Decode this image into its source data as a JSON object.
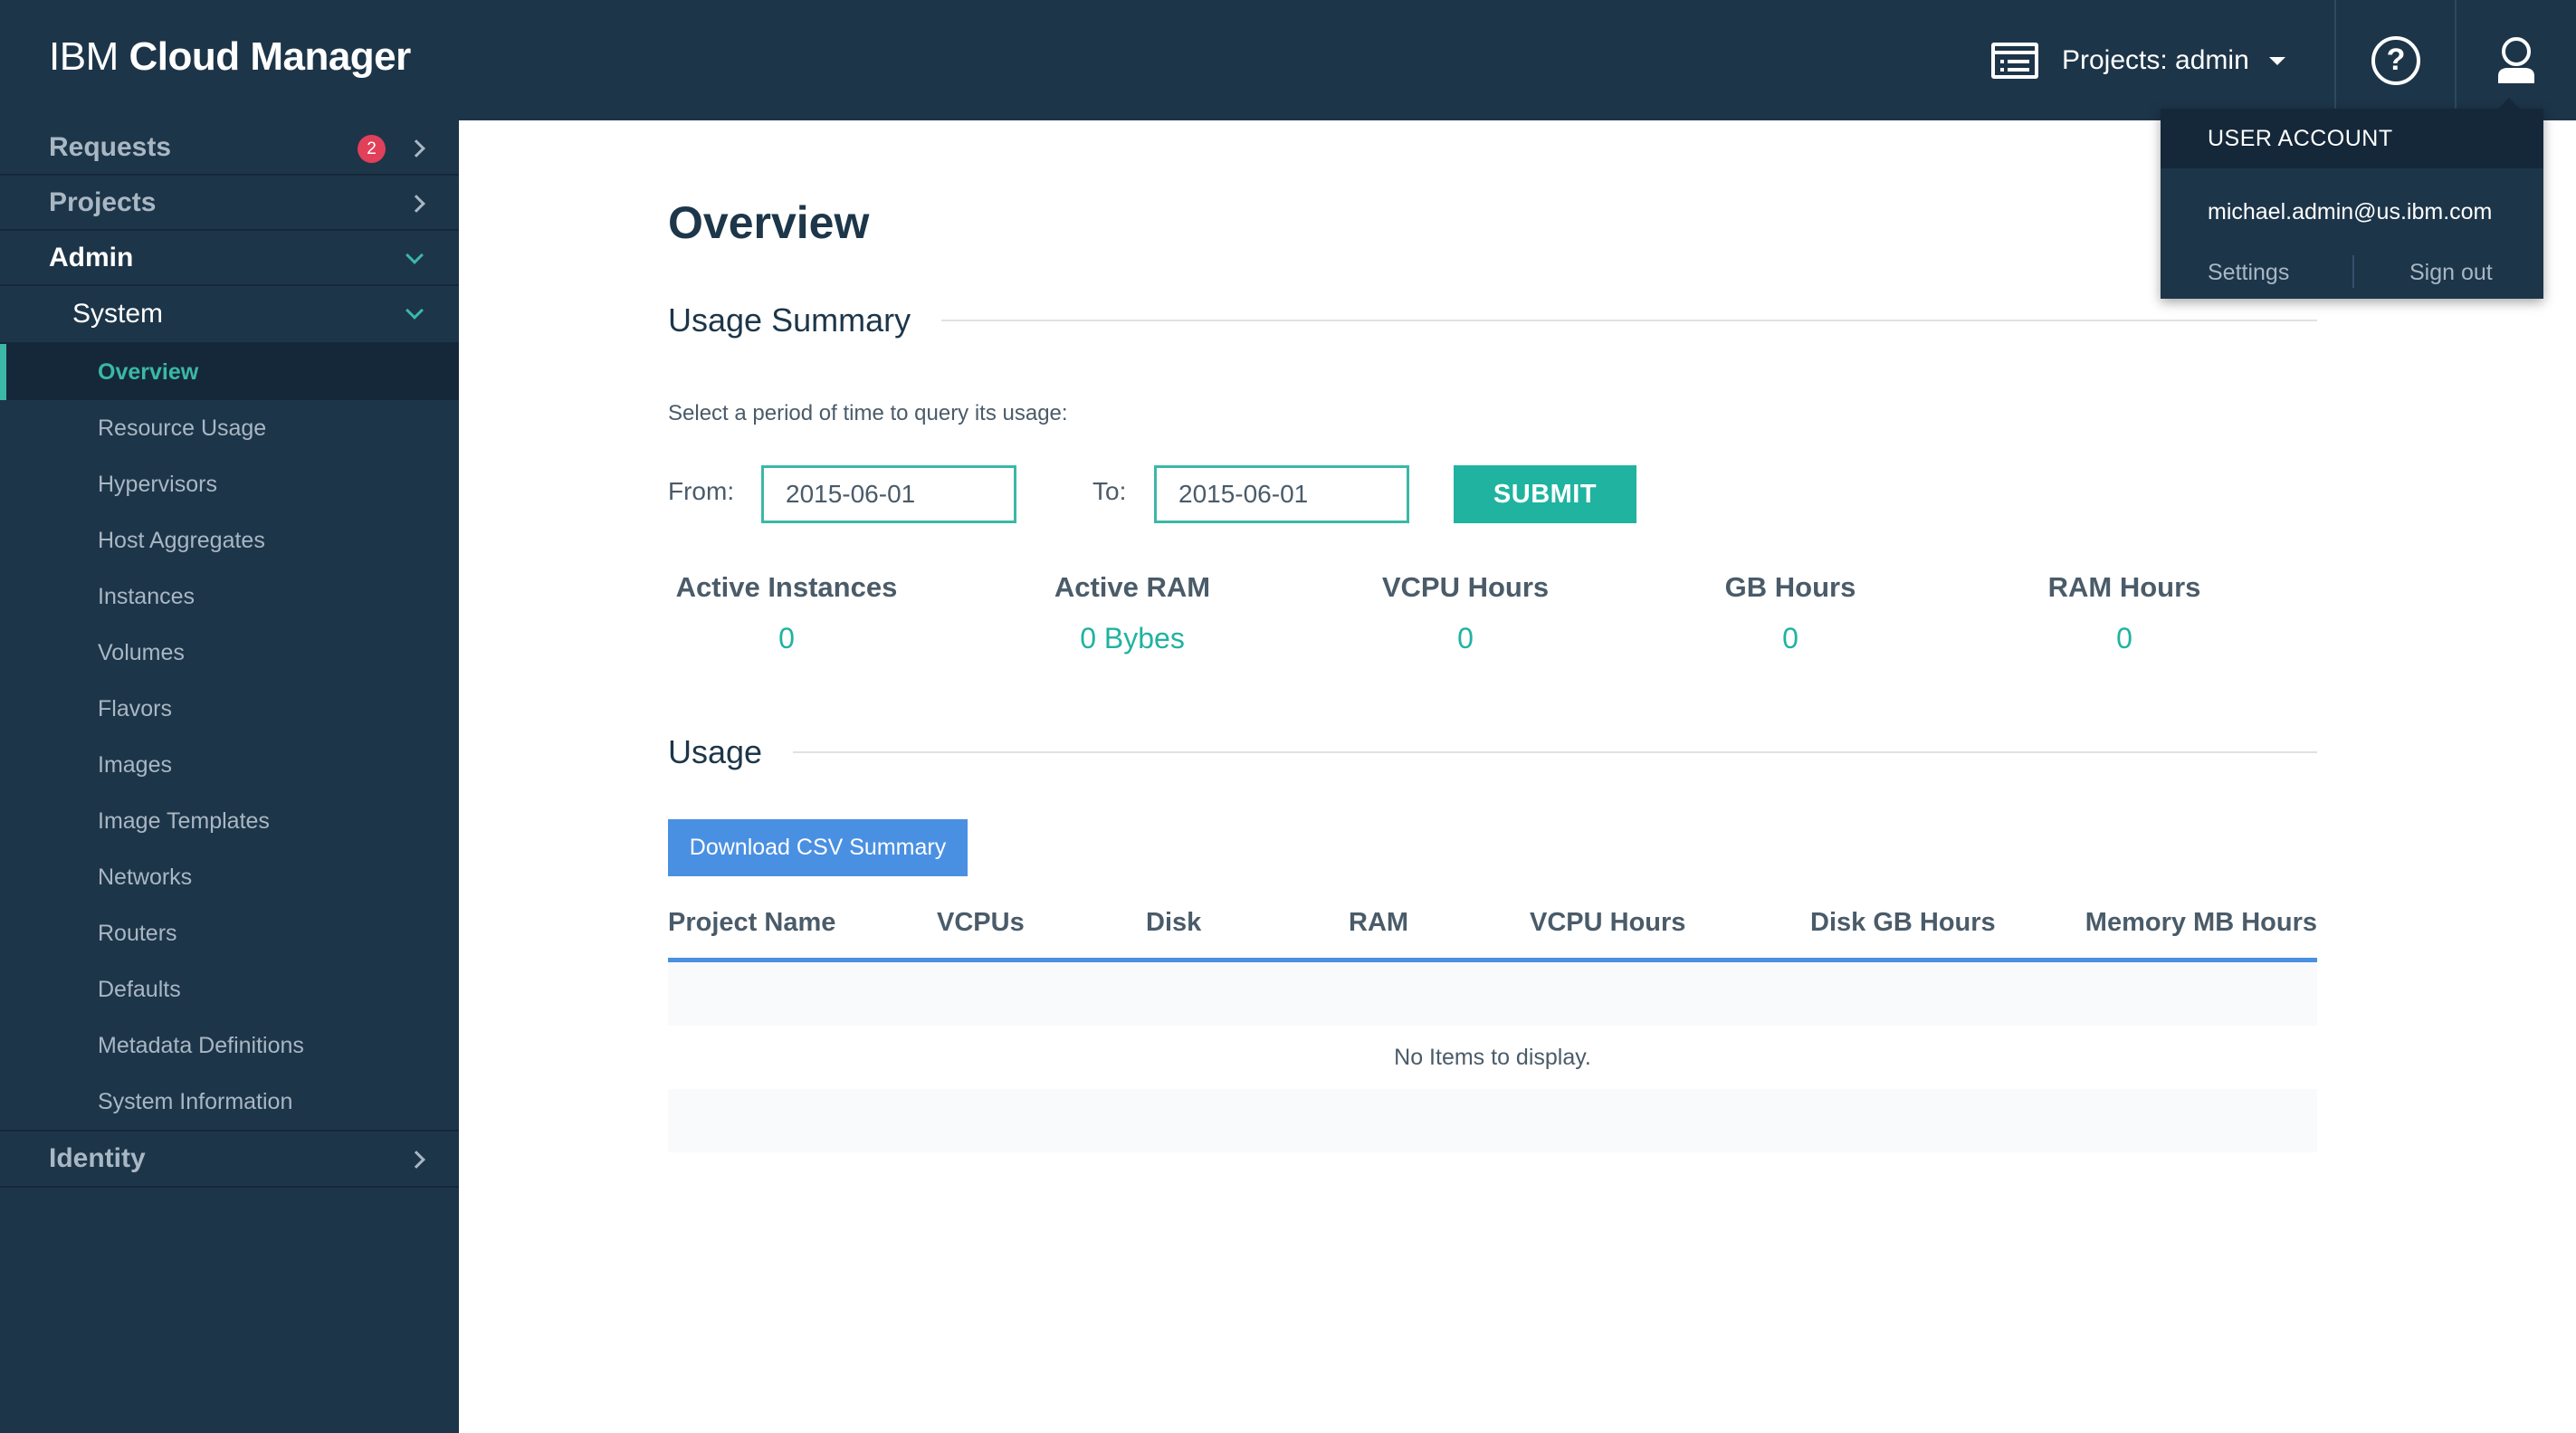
{
  "header": {
    "brand_light": "IBM",
    "brand_bold": "Cloud Manager",
    "projects_label": "Projects: admin",
    "help_glyph": "?"
  },
  "sidebar": {
    "requests": {
      "label": "Requests",
      "badge": "2"
    },
    "projects": {
      "label": "Projects"
    },
    "admin": {
      "label": "Admin"
    },
    "system": {
      "label": "System"
    },
    "items": [
      "Overview",
      "Resource Usage",
      "Hypervisors",
      "Host Aggregates",
      "Instances",
      "Volumes",
      "Flavors",
      "Images",
      "Image Templates",
      "Networks",
      "Routers",
      "Defaults",
      "Metadata Definitions",
      "System Information"
    ],
    "identity": {
      "label": "Identity"
    }
  },
  "main": {
    "title": "Overview",
    "usage_summary": {
      "heading": "Usage Summary",
      "hint": "Select a period of time to query its usage:",
      "from_label": "From:",
      "from_value": "2015-06-01",
      "to_label": "To:",
      "to_value": "2015-06-01",
      "submit_label": "SUBMIT"
    },
    "stats": [
      {
        "label": "Active Instances",
        "value": "0"
      },
      {
        "label": "Active RAM",
        "value": "0 Bybes"
      },
      {
        "label": "VCPU Hours",
        "value": "0"
      },
      {
        "label": "GB Hours",
        "value": "0"
      },
      {
        "label": "RAM Hours",
        "value": "0"
      }
    ],
    "usage": {
      "heading": "Usage",
      "csv_label": "Download CSV Summary",
      "columns": [
        "Project Name",
        "VCPUs",
        "Disk",
        "RAM",
        "VCPU Hours",
        "Disk GB Hours",
        "Memory MB Hours"
      ],
      "empty_text": "No Items to display."
    }
  },
  "user_menu": {
    "heading": "USER ACCOUNT",
    "email": "michael.admin@us.ibm.com",
    "settings": "Settings",
    "sign_out": "Sign out"
  },
  "colors": {
    "nav_bg": "#1d3549",
    "accent_teal": "#1fb3a0",
    "accent_blue": "#4a90e2",
    "badge_red": "#e0405a"
  }
}
